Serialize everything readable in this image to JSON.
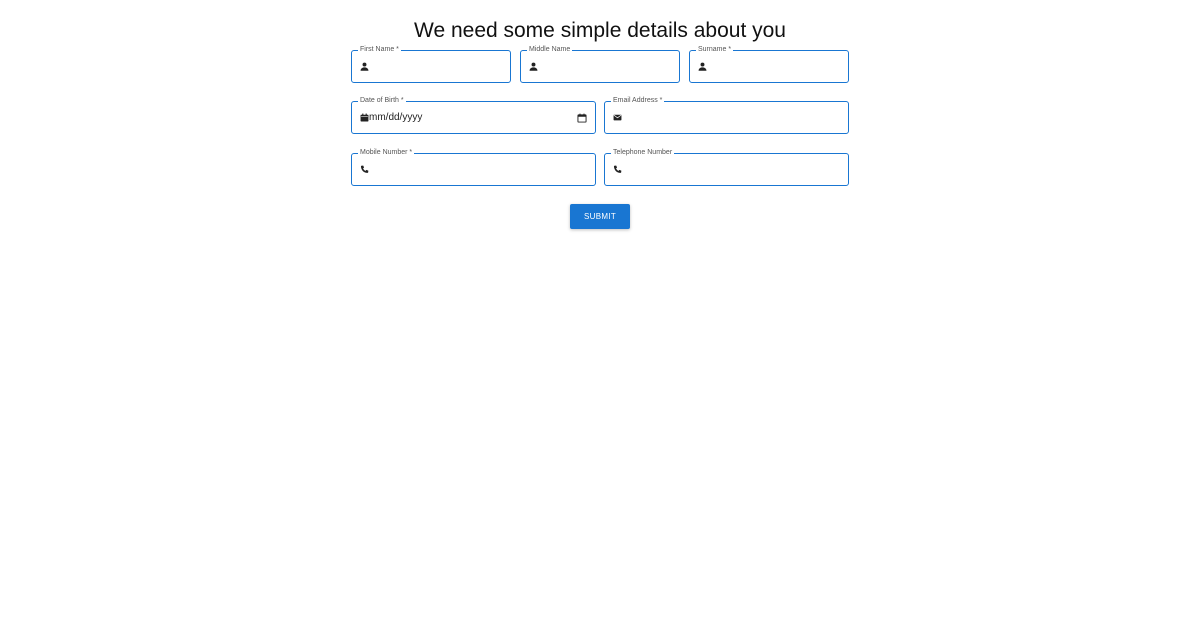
{
  "form": {
    "title": "We need some simple details about you",
    "first_name": {
      "label": "First Name *",
      "value": "",
      "icon": "person-icon"
    },
    "middle_name": {
      "label": "Middle Name",
      "value": "",
      "icon": "person-icon"
    },
    "surname": {
      "label": "Surname *",
      "value": "",
      "icon": "person-icon"
    },
    "date_of_birth": {
      "label": "Date of Birth *",
      "placeholder": "mm/dd/yyyy",
      "icon": "calendar-icon"
    },
    "email": {
      "label": "Email Address *",
      "value": "",
      "icon": "envelope-icon"
    },
    "mobile": {
      "label": "Mobile Number *",
      "value": "",
      "icon": "phone-icon"
    },
    "telephone": {
      "label": "Telephone Number",
      "value": "",
      "icon": "phone-icon"
    },
    "submit_label": "SUBMIT"
  },
  "colors": {
    "accent": "#1976d2",
    "background": "#ffffff",
    "text": "#222222"
  }
}
